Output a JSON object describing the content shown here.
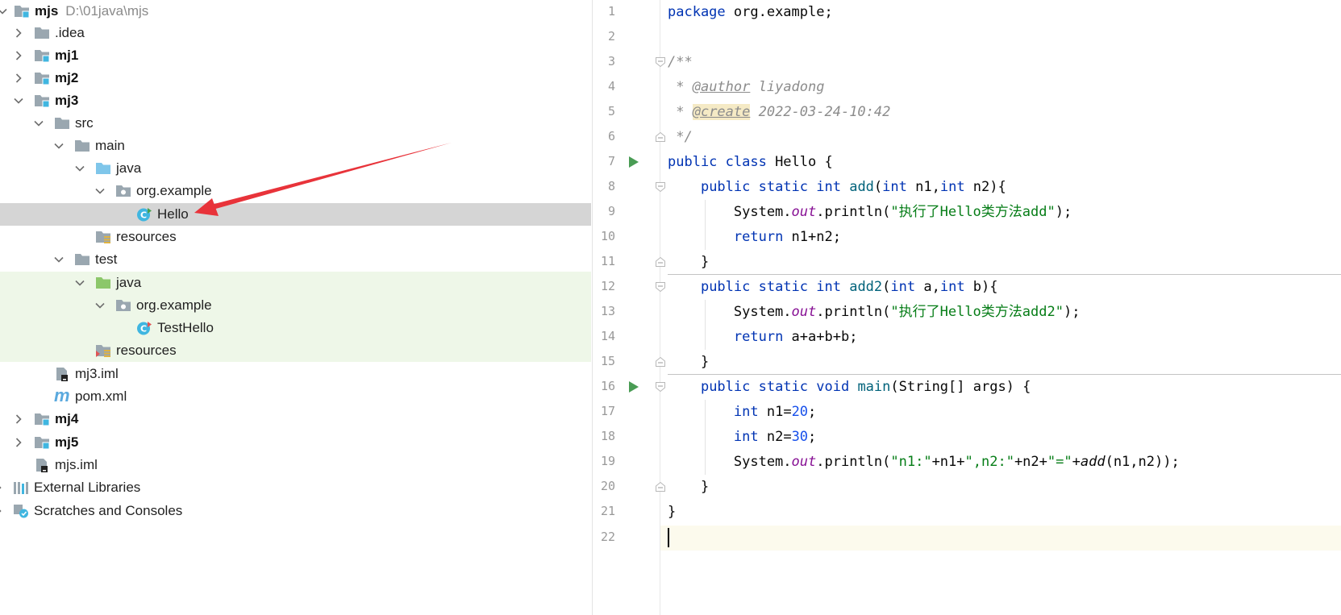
{
  "project_tree": {
    "root": {
      "name": "mjs",
      "path": "D:\\01java\\mjs"
    },
    "items": [
      {
        "label": ".idea"
      },
      {
        "label": "mj1"
      },
      {
        "label": "mj2"
      },
      {
        "label": "mj3"
      },
      {
        "label": "src"
      },
      {
        "label": "main"
      },
      {
        "label": "java"
      },
      {
        "label": "org.example"
      },
      {
        "label": "Hello"
      },
      {
        "label": "resources"
      },
      {
        "label": "test"
      },
      {
        "label": "java"
      },
      {
        "label": "org.example"
      },
      {
        "label": "TestHello"
      },
      {
        "label": "resources"
      },
      {
        "label": "mj3.iml"
      },
      {
        "label": "pom.xml"
      },
      {
        "label": "mj4"
      },
      {
        "label": "mj5"
      },
      {
        "label": "mjs.iml"
      },
      {
        "label": "External Libraries"
      },
      {
        "label": "Scratches and Consoles"
      }
    ],
    "selected": "Hello"
  },
  "editor": {
    "line_numbers": [
      "1",
      "2",
      "3",
      "4",
      "5",
      "6",
      "7",
      "8",
      "9",
      "10",
      "11",
      "12",
      "13",
      "14",
      "15",
      "16",
      "17",
      "18",
      "19",
      "20",
      "21",
      "22"
    ],
    "code": {
      "l1_kw": "package",
      "l1_rest": " org.example;",
      "l3": "/**",
      "l4_a": " * ",
      "l4_tag": "@author",
      "l4_b": " liyadong",
      "l5_a": " * ",
      "l5_tag": "@create",
      "l5_b": " 2022-03-24-10:42",
      "l6": " */",
      "l7_kw": "public class",
      "l7_rest": " Hello {",
      "l8_i": "    ",
      "l8_kw": "public static int",
      "l8_sp": " ",
      "l8_fn": "add",
      "l8_a": "(",
      "l8_k1": "int",
      "l8_b": " n1,",
      "l8_k2": "int",
      "l8_c": " n2){",
      "l9_i": "        System.",
      "l9_out": "out",
      "l9_a": ".println(",
      "l9_str": "\"执行了Hello类方法add\"",
      "l9_b": ");",
      "l10_i": "        ",
      "l10_kw": "return",
      "l10_rest": " n1+n2;",
      "l11": "    }",
      "l12_i": "    ",
      "l12_kw": "public static int",
      "l12_sp": " ",
      "l12_fn": "add2",
      "l12_a": "(",
      "l12_k1": "int",
      "l12_b": " a,",
      "l12_k2": "int",
      "l12_c": " b){",
      "l13_i": "        System.",
      "l13_out": "out",
      "l13_a": ".println(",
      "l13_str": "\"执行了Hello类方法add2\"",
      "l13_b": ");",
      "l14_i": "        ",
      "l14_kw": "return",
      "l14_rest": " a+a+b+b;",
      "l15": "    }",
      "l16_i": "    ",
      "l16_kw": "public static void",
      "l16_sp": " ",
      "l16_fn": "main",
      "l16_rest": "(String[] args) {",
      "l17_i": "        ",
      "l17_kw": "int",
      "l17_a": " n1=",
      "l17_num": "20",
      "l17_b": ";",
      "l18_i": "        ",
      "l18_kw": "int",
      "l18_a": " n2=",
      "l18_num": "30",
      "l18_b": ";",
      "l19_i": "        System.",
      "l19_out": "out",
      "l19_a": ".println(",
      "l19_s1": "\"n1:\"",
      "l19_b": "+n1+",
      "l19_s2": "\",n2:\"",
      "l19_c": "+n2+",
      "l19_s3": "\"=\"",
      "l19_d": "+",
      "l19_fn": "add",
      "l19_e": "(n1,n2));",
      "l20": "    }",
      "l21": "}"
    }
  },
  "colors": {
    "selection": "#d5d5d5",
    "test_highlight": "#eef7e8",
    "keyword": "#0033b3",
    "string": "#067d17",
    "number": "#1750eb",
    "field": "#871094",
    "comment": "#8c8c8c",
    "annotation_arrow": "#e8333a",
    "run_icon": "#499c54"
  },
  "icons": [
    "chevron-right-icon",
    "chevron-down-icon",
    "folder-icon",
    "module-folder-icon",
    "source-folder-icon",
    "test-folder-icon",
    "package-icon",
    "java-class-icon",
    "resources-folder-icon",
    "iml-file-icon",
    "maven-icon",
    "libraries-icon",
    "scratches-icon",
    "run-gutter-icon",
    "fold-marker-icon"
  ]
}
